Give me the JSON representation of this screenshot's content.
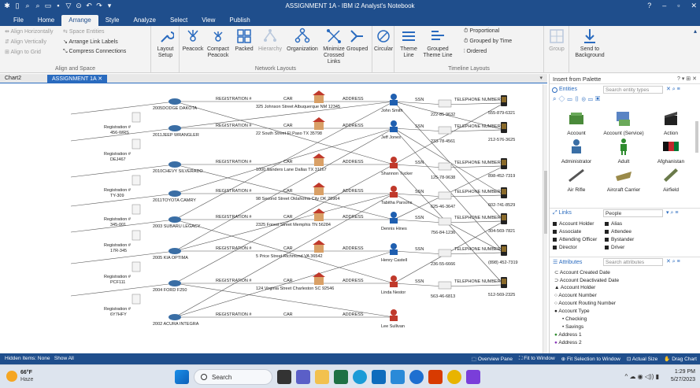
{
  "window": {
    "title": "ASSIGNMENT 1A - IBM i2 Analyst's Notebook",
    "help": "?",
    "minimize": "–",
    "maximize": "▫",
    "close": "✕"
  },
  "menu": {
    "tabs": [
      "File",
      "Home",
      "Arrange",
      "Style",
      "Analyze",
      "Select",
      "View",
      "Publish"
    ],
    "active_index": 2
  },
  "ribbon": {
    "align_space": {
      "label": "Align and Space",
      "align_horizontally": "Align Horizontally",
      "align_vertically": "Align Vertically",
      "align_to_grid": "Align to Grid",
      "space_entities": "Space Entities",
      "arrange_link_labels": "Arrange Link Labels",
      "compress_connections": "Compress Connections"
    },
    "layout_setup": "Layout\nSetup",
    "network_layouts": {
      "label": "Network Layouts",
      "buttons": [
        "Peacock",
        "Compact Peacock",
        "Packed",
        "Hierarchy",
        "Organization",
        "Minimize Crossed Links",
        "Grouped",
        "Circular"
      ]
    },
    "timeline_layouts": {
      "label": "Timeline Layouts",
      "theme_line": "Theme Line",
      "grouped_theme_line": "Grouped Theme Line",
      "proportional": "Proportional",
      "grouped_by_time": "Grouped by Time",
      "ordered": "Ordered"
    },
    "group": "Group",
    "send_to_background": "Send to Background"
  },
  "doc_tabs": [
    "Chart2",
    "ASSIGNMENT 1A"
  ],
  "chart": {
    "vehicles": [
      "2005DODGE DAKOTA",
      "2011JEEP WRANGLER",
      "2010CHEVY SILVERADO",
      "2011TOYOTA CAMRY",
      "2003 SUBARU LEGACY",
      "2005 KIA OPTIMA",
      "2004 FORD F250",
      "2002 ACURA INTEGRA"
    ],
    "registrations": [
      "Registration # 456-WRS",
      "Registration # DEJ467",
      "Registration # TY-309",
      "Registration # 345-001",
      "Registration # 17R-345",
      "Registration # PCF111",
      "Registration # 6Y7HFY"
    ],
    "addresses": [
      "325 Johnson Street Albuquerque NM 12345",
      "22 South Street El Paso TX 35798",
      "1000 Sanders Lane Dallas TX 31167",
      "98 Second Street Oklahoma City OK 28964",
      "2325 Forest Street Memphis TN 56284",
      "5 Price Street Richmond VA 36542",
      "124 Virginia Street Charleston SC 92546"
    ],
    "people": [
      "John Smith",
      "Jeff Jones",
      "Shannon Tucker",
      "Tabitha Parsons",
      "Dennis Hines",
      "Henry Castell",
      "Linda Nestor",
      "Lee Sullivan"
    ],
    "ssns": [
      "222-85-9632",
      "233-78-4561",
      "125-78-9638",
      "625-46-3647",
      "756-84-1236",
      "236-55-6666",
      "563-46-6813"
    ],
    "phones": [
      "555-879-6321",
      "212-576-3625",
      "898-452-7319",
      "602-741-8529",
      "304-569-7821",
      "(898) 452-7319",
      "512-569-2325"
    ],
    "link_labels": {
      "registration": "REGISTRATION #",
      "registration_number": "REGISTRATION NUMBER",
      "car": "CAR",
      "address": "ADDRESS",
      "ssn": "SSN",
      "telephone": "TELEPHONE NUMBER"
    }
  },
  "palette": {
    "title": "Insert from Palette",
    "entities_label": "Entities",
    "entities_search": "Search entity types",
    "entities": [
      "Account",
      "Account (Service)",
      "Action",
      "Administrator",
      "Adult",
      "Afghanistan",
      "Air Rifle",
      "Aircraft Carrier",
      "Airfield"
    ],
    "links_label": "Links",
    "links_search": "People",
    "links": [
      "Account Holder",
      "Alias",
      "Associate",
      "Attendee",
      "Attending Officer",
      "Bystander",
      "Director",
      "Driver"
    ],
    "attributes_label": "Attributes",
    "attributes_search": "Search attributes",
    "attributes": [
      "Account Created Date",
      "Account Deactivated Date",
      "Account Holder",
      "Account Number",
      "Account Routing Number",
      "Account Type",
      "Checking",
      "Savings",
      "Address 1",
      "Address 2"
    ]
  },
  "status": {
    "hidden_items": "Hidden Items: None",
    "show_all": "Show All",
    "overview_pane": "Overview Pane",
    "fit_to_window": "Fit to Window",
    "fit_selection": "Fit Selection to Window",
    "actual_size": "Actual Size",
    "drag_chart": "Drag Chart"
  },
  "taskbar": {
    "temperature": "66°F",
    "condition": "Haze",
    "search": "Search",
    "time": "1:29 PM",
    "date": "5/27/2023"
  },
  "colors": {
    "title_bar": "#1f4e8c",
    "accent": "#2a6bbf"
  }
}
